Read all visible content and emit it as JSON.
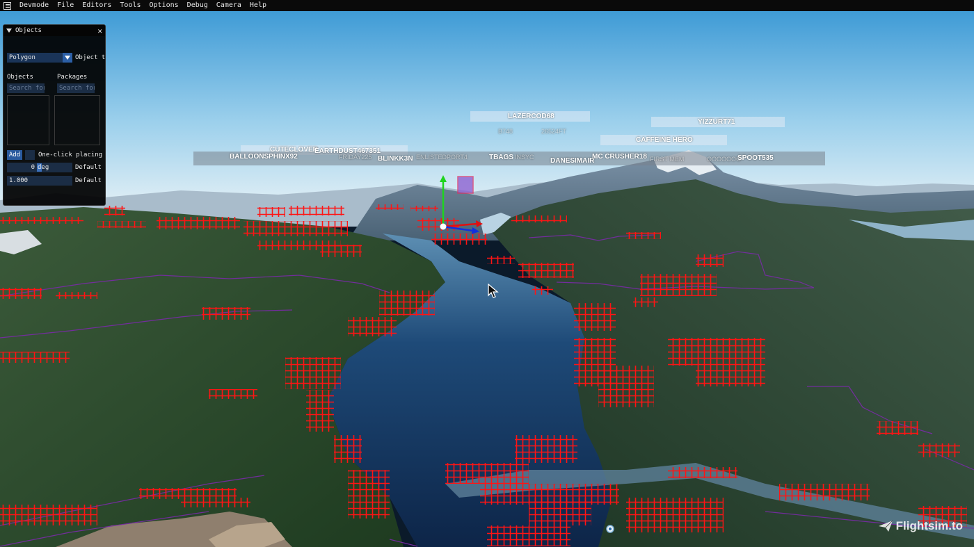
{
  "menubar": {
    "app_name": "Devmode",
    "items": [
      "File",
      "Editors",
      "Tools",
      "Options",
      "Debug",
      "Camera",
      "Help"
    ]
  },
  "objects_panel": {
    "title": "Objects",
    "close_glyph": "✕",
    "type_value": "Polygon",
    "type_side_label": "Object t",
    "objects_label": "Objects",
    "packages_label": "Packages",
    "objects_search_placeholder": "Search for",
    "packages_search_placeholder": "Search for",
    "add_label": "Add",
    "one_click_label": "One-click placing",
    "rotation_value": "0",
    "rotation_unit": "deg",
    "rotation_default": "Default",
    "scale_value": "1.000",
    "scale_default": "Default"
  },
  "callsigns": [
    "LAZERCOD68",
    "B748",
    "26524FT",
    "YIZZURT71",
    "CAFFEINE HERO",
    "CUTECLOVER",
    "EARTHDUST467351",
    "BALLOONSPHINX92",
    "FRIDAY225",
    "BLINKK3N",
    "ENLISTEDPORT4",
    "TBAGS",
    "INSYC",
    "DANESIMAIR",
    "MC CRUSHER18",
    "FIRST MEM",
    "OOOOOOO",
    "SPOOT535"
  ],
  "watermark": "Flightsim.to",
  "colors": {
    "menubar_bg": "#0a0a0a",
    "panel_bg": "#000000",
    "field_bg": "#1b2d45",
    "button_blue": "#2a5a9e",
    "polygon_vertex": "#ff1a1a",
    "polygon_edge": "#7a2aa8",
    "gizmo_y": "#1fd41f",
    "gizmo_x": "#e01010",
    "gizmo_z": "#1030e0"
  }
}
